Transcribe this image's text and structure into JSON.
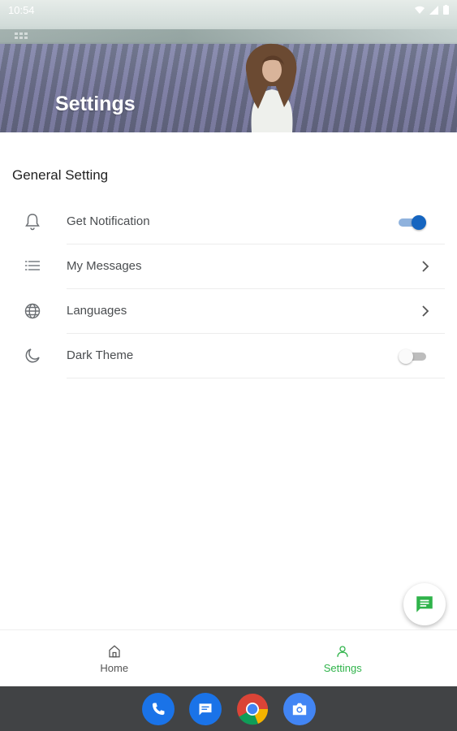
{
  "status_bar": {
    "time": "10:54"
  },
  "header": {
    "title": "Settings"
  },
  "section": {
    "title": "General Setting"
  },
  "settings": [
    {
      "label": "Get Notification",
      "icon": "bell-icon",
      "control": "toggle",
      "value": true
    },
    {
      "label": "My Messages",
      "icon": "list-icon",
      "control": "chevron"
    },
    {
      "label": "Languages",
      "icon": "globe-icon",
      "control": "chevron"
    },
    {
      "label": "Dark Theme",
      "icon": "moon-icon",
      "control": "toggle",
      "value": false
    }
  ],
  "bottom_nav": [
    {
      "label": "Home",
      "icon": "home-icon",
      "active": false
    },
    {
      "label": "Settings",
      "icon": "person-icon",
      "active": true
    }
  ],
  "colors": {
    "accent_green": "#2fb34a",
    "toggle_blue": "#1565c0",
    "dock": "#414345"
  },
  "dock_apps": [
    "phone-icon",
    "messages-icon",
    "chrome-icon",
    "camera-icon"
  ]
}
